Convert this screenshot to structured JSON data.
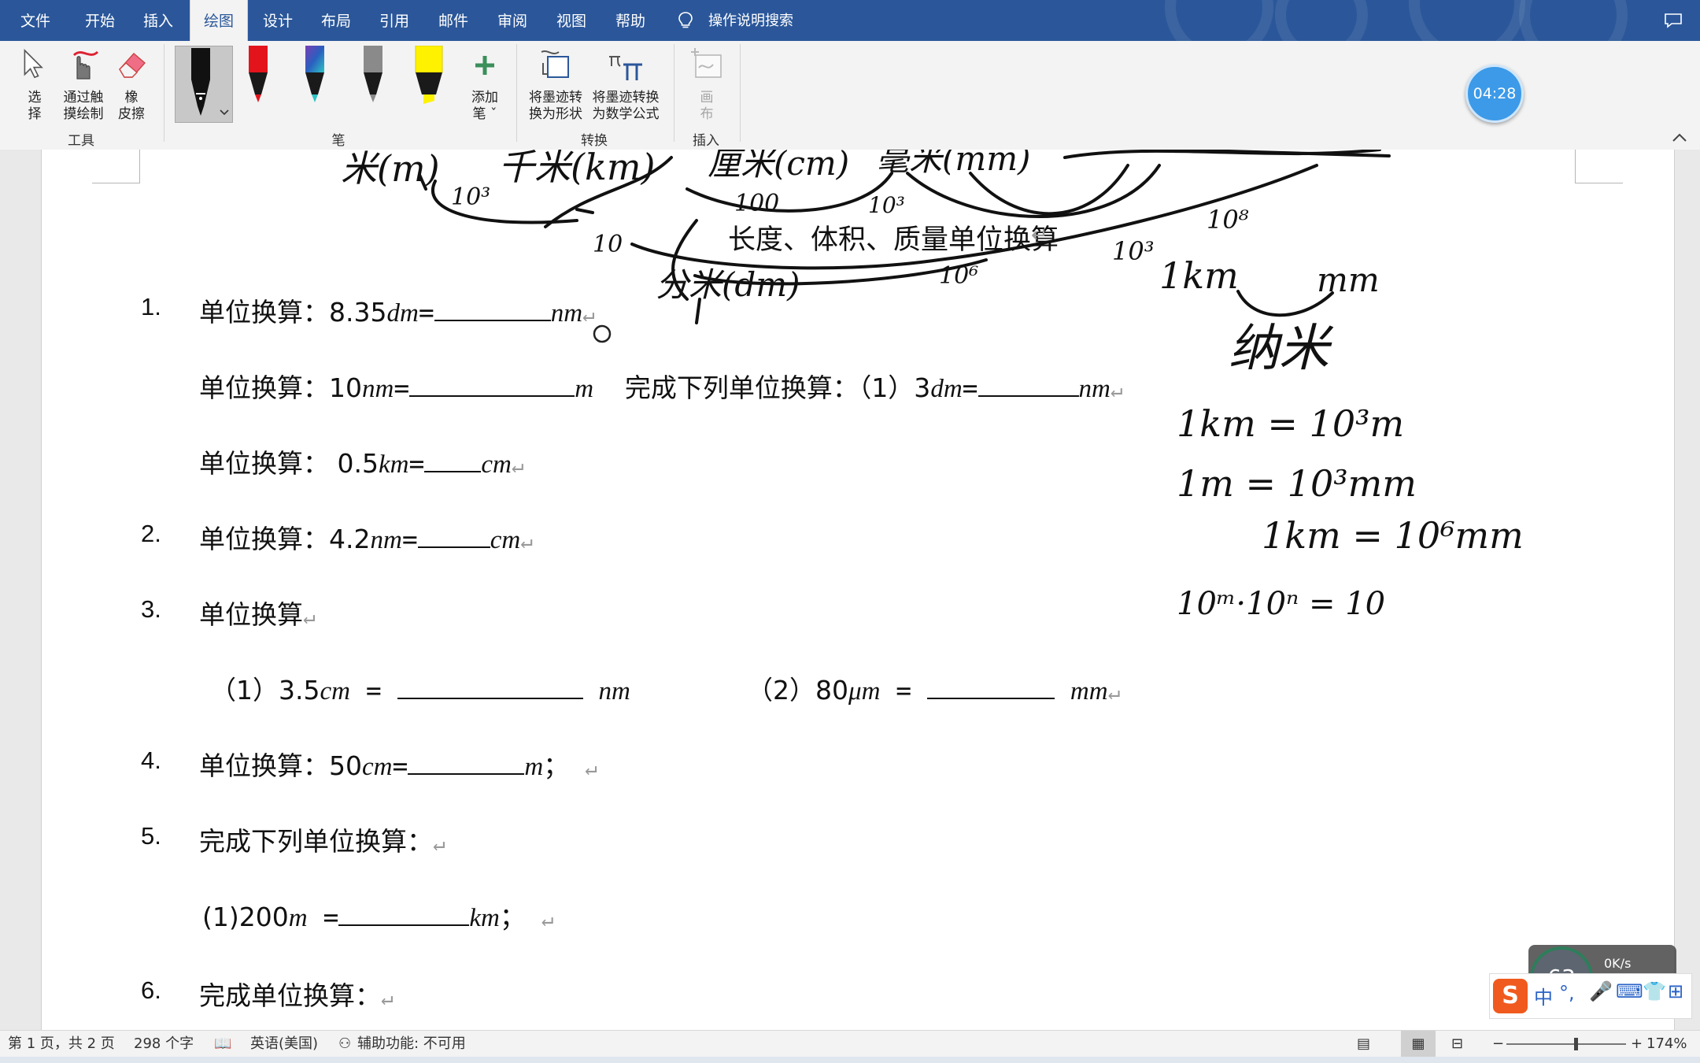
{
  "menu": {
    "tabs": [
      "文件",
      "开始",
      "插入",
      "绘图",
      "设计",
      "布局",
      "引用",
      "邮件",
      "审阅",
      "视图",
      "帮助"
    ],
    "active_tab": "绘图",
    "search_label": "操作说明搜索"
  },
  "ribbon": {
    "tools_group": {
      "label": "工具",
      "select_line1": "选",
      "select_line2": "择",
      "touch_line1": "通过触",
      "touch_line2": "摸绘制",
      "eraser_line1": "橡",
      "eraser_line2": "皮擦"
    },
    "pens_group": {
      "label": "笔",
      "pens": [
        {
          "name": "black-pen",
          "color": "#111111"
        },
        {
          "name": "red-pen",
          "color": "#e3141c"
        },
        {
          "name": "galaxy-pen",
          "color": "#2a5fbf"
        },
        {
          "name": "gray-pen",
          "color": "#8a8a8a"
        },
        {
          "name": "highlighter",
          "color": "#fff200"
        }
      ],
      "add_line1": "添加",
      "add_line2": "笔"
    },
    "convert_group": {
      "label": "转换",
      "shape_line1": "将墨迹转",
      "shape_line2": "换为形状",
      "math_line1": "将墨迹转换",
      "math_line2": "为数学公式"
    },
    "insert_group": {
      "label": "插入",
      "canvas_line1": "画",
      "canvas_line2": "布"
    }
  },
  "timer": "04:28",
  "document": {
    "title": "长度、体积、质量单位换算",
    "items": [
      {
        "num": "1.",
        "prefix": "单位换算：8.35",
        "unit1": "dm",
        "eq": "=",
        "unit2": "nm"
      },
      {
        "prefix": "单位换算：10",
        "unit1": "nm",
        "eq": "=",
        "unit2": "m",
        "extra": "完成下列单位换算：（1）3",
        "unit3": "dm",
        "unit4": "nm"
      },
      {
        "prefix": "单位换算：   0.5",
        "unit1": "km",
        "eq": "=",
        "unit2": "cm"
      },
      {
        "num": "2.",
        "prefix": "单位换算：4.2",
        "unit1": "nm",
        "eq": "=",
        "unit2": "cm"
      },
      {
        "num": "3.",
        "prefix": "单位换算"
      },
      {
        "part1_prefix": "（1）3.5",
        "part1_unit": "cm",
        "part1_eq": " = ",
        "part1_target": "nm",
        "part2_prefix": "（2）80",
        "part2_unit": "μm",
        "part2_eq": " = ",
        "part2_target": "mm"
      },
      {
        "num": "4.",
        "prefix": "单位换算：50",
        "unit1": "cm",
        "eq": "=",
        "unit2": "m",
        "end": "；"
      },
      {
        "num": "5.",
        "prefix": "完成下列单位换算："
      },
      {
        "prefix": "(1)200",
        "unit1": "m",
        "eq": " =",
        "unit2": "km",
        "end": "；"
      },
      {
        "num": "6.",
        "prefix": "完成单位换算："
      }
    ]
  },
  "handwriting": {
    "units_row": [
      "米(m)",
      "千米(km)",
      "厘米(cm)",
      "毫米(mm)"
    ],
    "labels": [
      "10³",
      "100",
      "10³",
      "10",
      "10³",
      "10⁸",
      "10⁶",
      "分米(dm)",
      "1km",
      "mm",
      "纳米",
      "1km = 10³m",
      "1m = 10³mm",
      "1km = 10⁶mm",
      "10ᵐ·10ⁿ = 10"
    ],
    "ink_color": "#111111"
  },
  "status_bar": {
    "page_info": "第 1 页，共 2 页",
    "word_count": "298 个字",
    "language": "英语(美国)",
    "accessibility": "辅助功能: 不可用",
    "zoom": "174%"
  },
  "widgets": {
    "speed_value": "63",
    "net_speed": "0K/s",
    "ime_mode": "中"
  }
}
